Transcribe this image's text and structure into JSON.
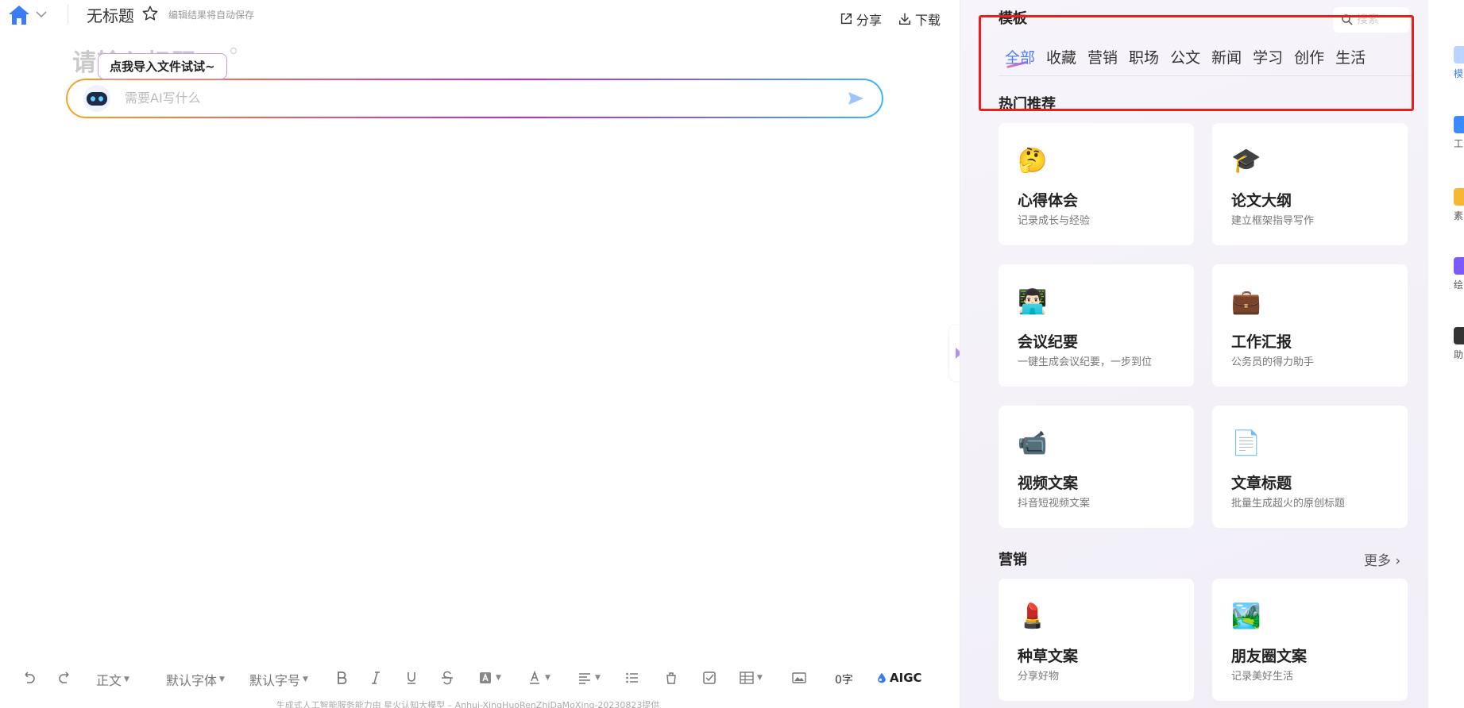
{
  "header": {
    "doc_title": "无标题",
    "autosave": "编辑结果将自动保存",
    "share": "分享",
    "download": "下载"
  },
  "editor": {
    "title_placeholder": "请输入标题",
    "tooltip": "点我导入文件试试~",
    "ai_placeholder": "需要AI写什么"
  },
  "toolbar": {
    "paragraph": "正文",
    "font": "默认字体",
    "size": "默认字号",
    "word_count": "0字",
    "aigc": "AIGC"
  },
  "footer": "生成式人工智能服务能力由 星火认知大模型 – Anhui-XingHuoRenZhiDaMoXing-20230823提供",
  "panel": {
    "title": "模板",
    "search_placeholder": "搜索",
    "tabs": [
      "全部",
      "收藏",
      "营销",
      "职场",
      "公文",
      "新闻",
      "学习",
      "创作",
      "生活"
    ],
    "hot_title": "热门推荐",
    "hot_cards": [
      {
        "emoji": "🤔",
        "title": "心得体会",
        "sub": "记录成长与经验"
      },
      {
        "emoji": "🎓",
        "title": "论文大纲",
        "sub": "建立框架指导写作"
      },
      {
        "emoji": "👨🏻‍💻",
        "title": "会议纪要",
        "sub": "一键生成会议纪要，一步到位"
      },
      {
        "emoji": "💼",
        "title": "工作汇报",
        "sub": "公务员的得力助手"
      },
      {
        "emoji": "📹",
        "title": "视频文案",
        "sub": "抖音短视频文案"
      },
      {
        "emoji": "📄",
        "title": "文章标题",
        "sub": "批量生成超火的原创标题"
      }
    ],
    "marketing_title": "营销",
    "more": "更多 ›",
    "marketing_cards": [
      {
        "emoji": "💄",
        "title": "种草文案",
        "sub": "分享好物"
      },
      {
        "emoji": "🏞️",
        "title": "朋友圈文案",
        "sub": "记录美好生活"
      }
    ]
  },
  "rail": {
    "items": [
      {
        "label": "模",
        "color": "#b9d4ff"
      },
      {
        "label": "工",
        "color": "#3a8bff"
      },
      {
        "label": "素",
        "color": "#f7b733"
      },
      {
        "label": "绘",
        "color": "#7b5bff"
      },
      {
        "label": "助",
        "color": "#333333"
      }
    ]
  },
  "colors": {
    "accent": "#4e7bf5",
    "highlight_box": "#ee1c1c"
  }
}
